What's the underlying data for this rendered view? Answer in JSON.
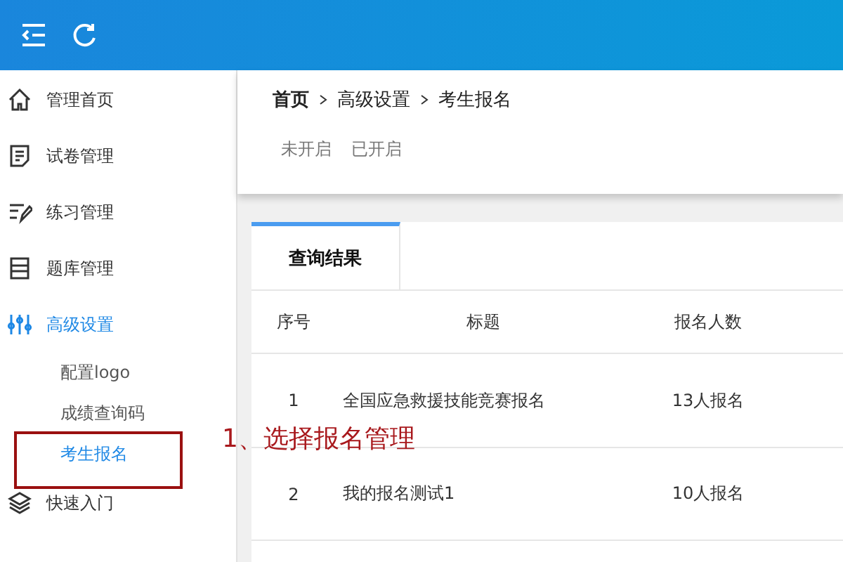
{
  "sidebar": {
    "items": [
      {
        "label": "管理首页",
        "expanded": false
      },
      {
        "label": "试卷管理",
        "expanded": false
      },
      {
        "label": "练习管理",
        "expanded": false
      },
      {
        "label": "题库管理",
        "expanded": false
      },
      {
        "label": "高级设置",
        "expanded": true,
        "children": [
          {
            "label": "配置logo",
            "selected": false
          },
          {
            "label": "成绩查询码",
            "selected": false
          },
          {
            "label": "考生报名",
            "selected": true
          }
        ]
      },
      {
        "label": "快速入门",
        "expanded": false
      }
    ]
  },
  "breadcrumb": [
    "首页",
    "高级设置",
    "考生报名"
  ],
  "filters": [
    "未开启",
    "已开启"
  ],
  "card": {
    "tab": "查询结果"
  },
  "table": {
    "columns": [
      "序号",
      "标题",
      "报名人数"
    ],
    "rows": [
      [
        "1",
        "全国应急救援技能竞赛报名",
        "13人报名"
      ],
      [
        "2",
        "我的报名测试1",
        "10人报名"
      ]
    ]
  },
  "annotation": "1、选择报名管理"
}
